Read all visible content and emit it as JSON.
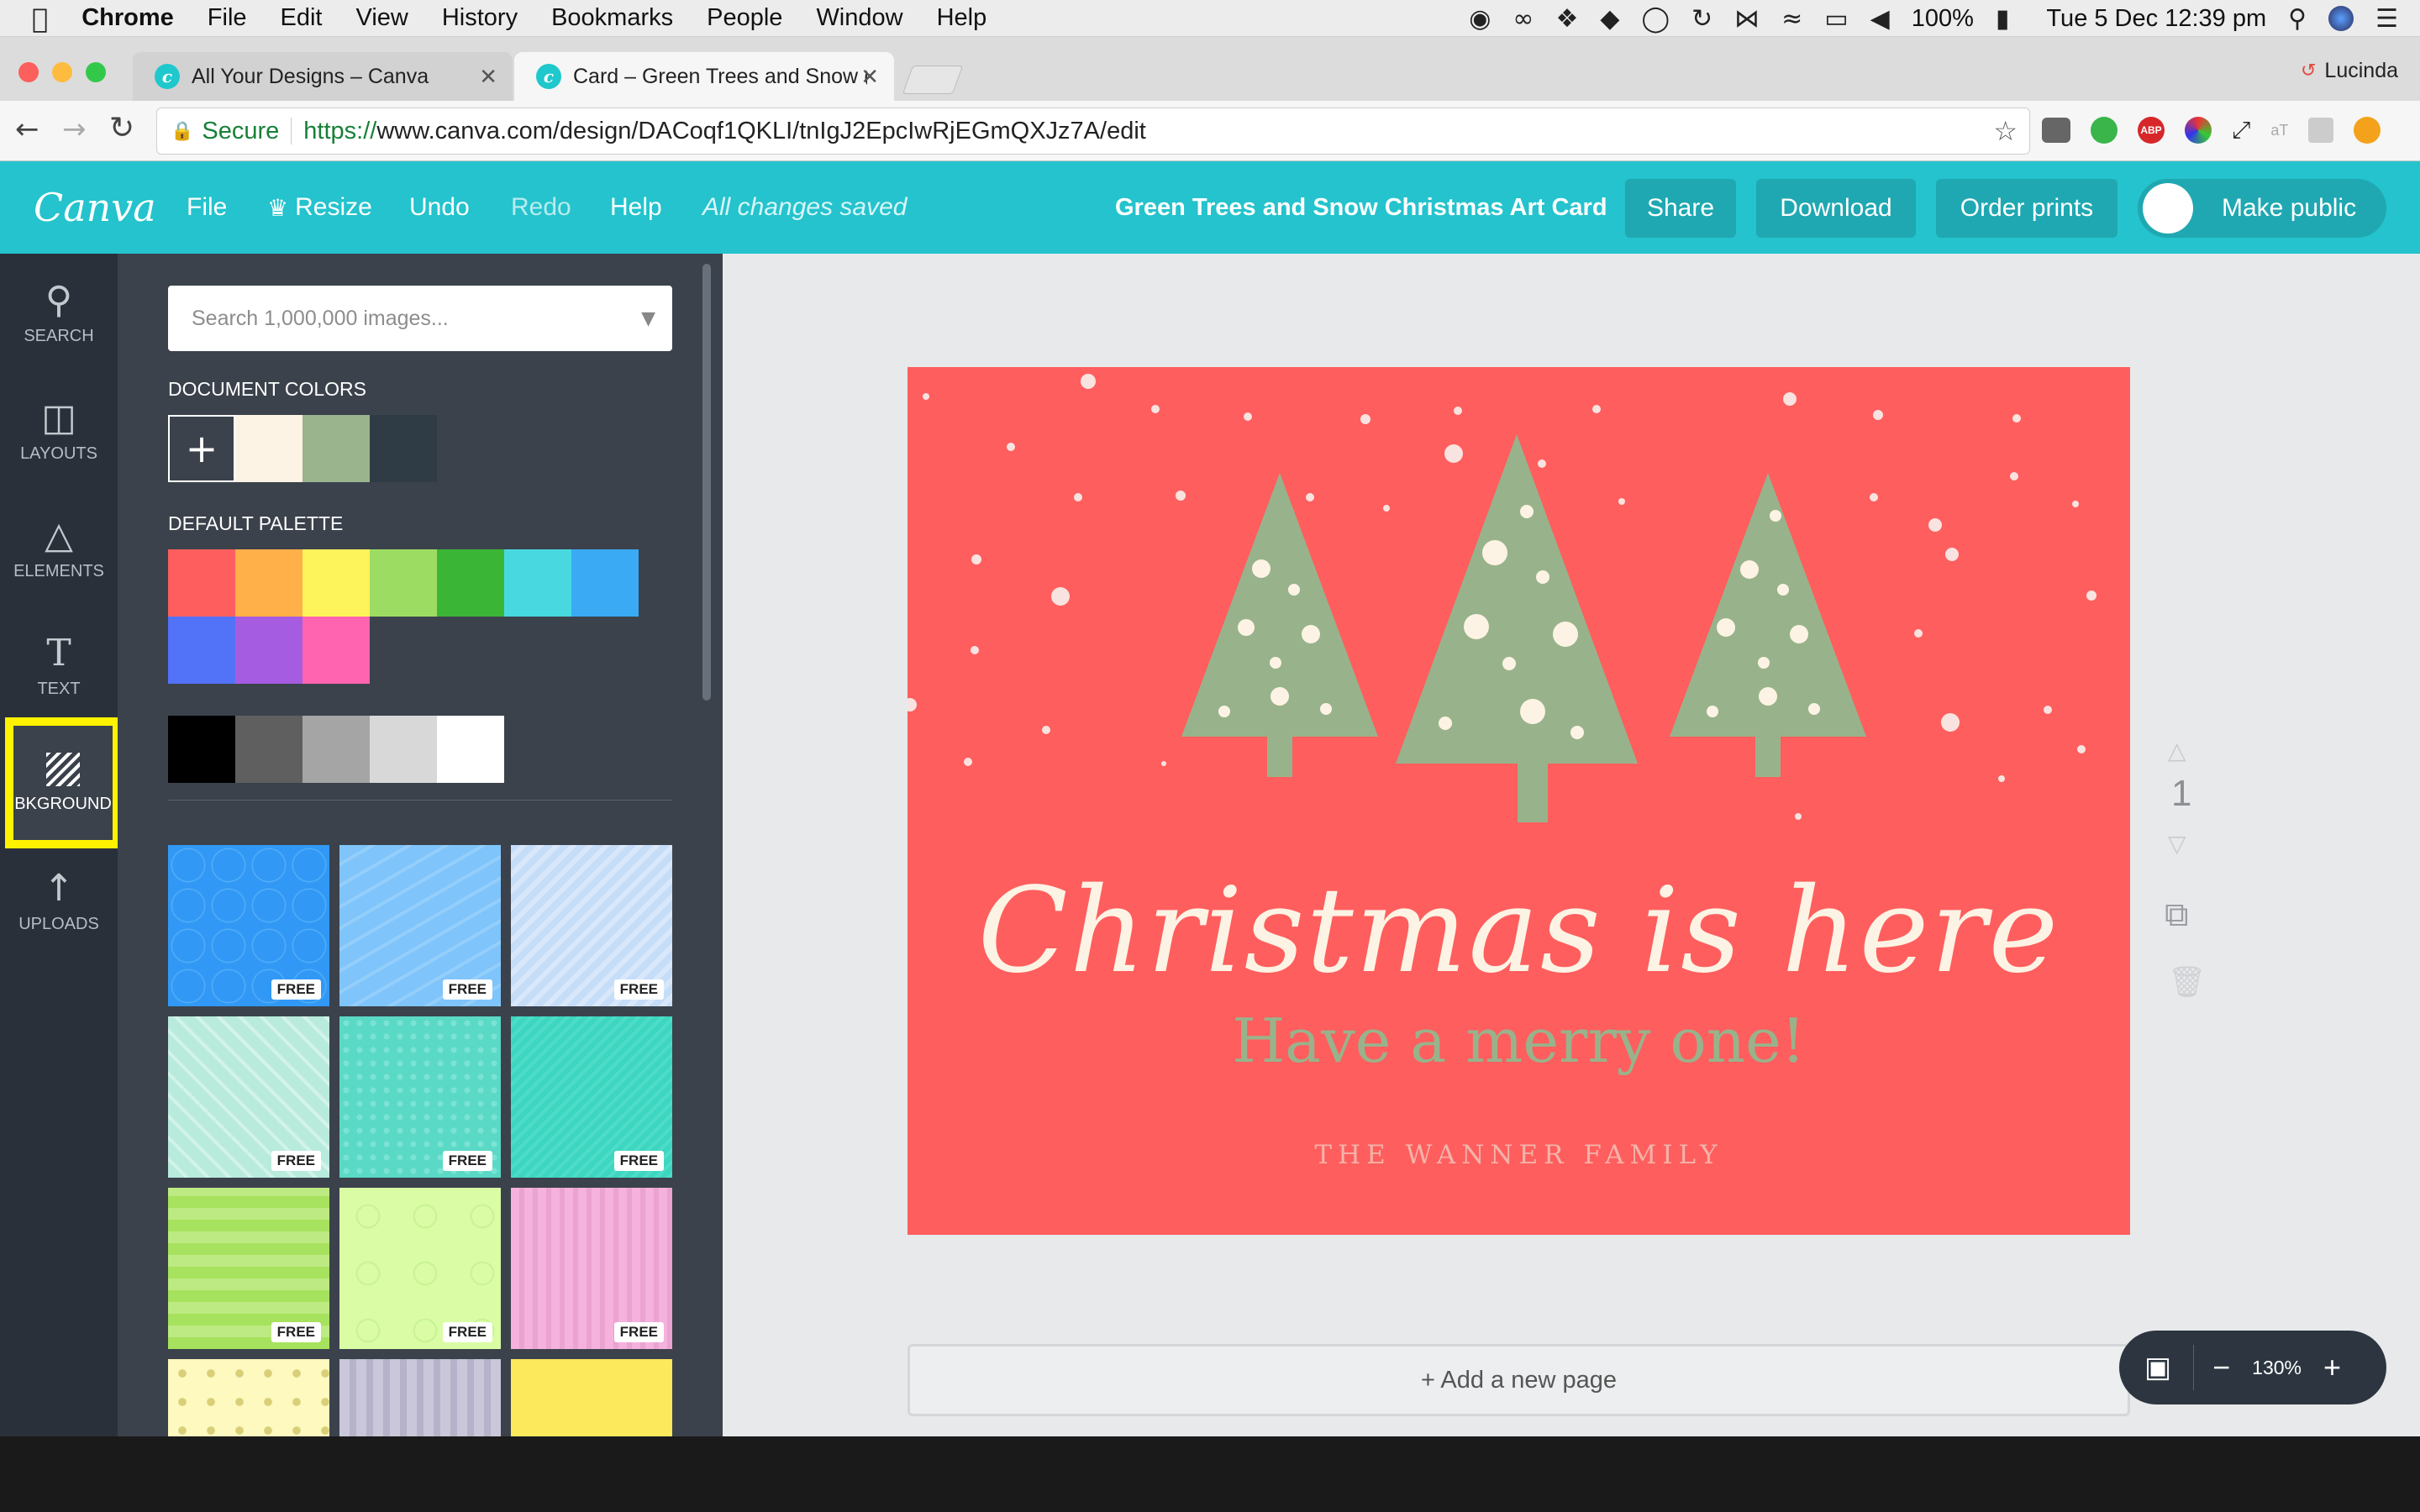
{
  "menubar": {
    "apple_icon": "apple-icon",
    "app_name": "Chrome",
    "items": [
      "File",
      "Edit",
      "View",
      "History",
      "Bookmarks",
      "People",
      "Window",
      "Help"
    ],
    "battery": "100%",
    "datetime": "Tue 5 Dec  12:39 pm"
  },
  "browser": {
    "tabs": [
      {
        "title": "All Your Designs – Canva",
        "active": false
      },
      {
        "title": "Card – Green Trees and Snow (",
        "active": true
      }
    ],
    "profile_name": "Lucinda",
    "secure_label": "Secure",
    "url_scheme": "https://",
    "url_rest": "www.canva.com/design/DACoqf1QKLI/tnIgJ2EpcIwRjEGmQXJz7A/edit"
  },
  "canva_toolbar": {
    "logo": "Canva",
    "file": "File",
    "resize": "Resize",
    "undo": "Undo",
    "redo": "Redo",
    "help": "Help",
    "status": "All changes saved",
    "design_title": "Green Trees and Snow Christmas Art Card",
    "share": "Share",
    "download": "Download",
    "order_prints": "Order prints",
    "make_public": "Make public"
  },
  "sidebar": {
    "items": [
      {
        "label": "SEARCH",
        "icon": "search-icon"
      },
      {
        "label": "LAYOUTS",
        "icon": "layouts-icon"
      },
      {
        "label": "ELEMENTS",
        "icon": "elements-icon"
      },
      {
        "label": "TEXT",
        "icon": "text-icon"
      },
      {
        "label": "BKGROUND",
        "icon": "background-icon"
      },
      {
        "label": "UPLOADS",
        "icon": "uploads-icon"
      }
    ]
  },
  "panel": {
    "search_placeholder": "Search 1,000,000 images...",
    "doc_colors_label": "DOCUMENT COLORS",
    "doc_colors": [
      "#fdf3e4",
      "#9ab48e",
      "#2f3b45"
    ],
    "default_palette_label": "DEFAULT PALETTE",
    "palette_row1": [
      "#ff5e5e",
      "#ffb049",
      "#fdf35b",
      "#9ddc62",
      "#3bb536",
      "#48d9e0",
      "#3aaaf5"
    ],
    "palette_row2": [
      "#5273f7",
      "#a65ce0",
      "#ff64b0"
    ],
    "grays": [
      "#000000",
      "#5f5f5f",
      "#a5a5a5",
      "#d8d8d8",
      "#ffffff"
    ],
    "free_label": "FREE",
    "backgrounds": [
      "#3199f5",
      "#7fc4fb",
      "#c6ddf7",
      "#b8ebdc",
      "#5ad9c6",
      "#3dd6c0",
      "#a7e25e",
      "#d9fca5",
      "#f4b2dd",
      "#fdf9bf",
      "#c9c7d9",
      "#fde95c"
    ]
  },
  "card": {
    "headline": "Christmas is here",
    "subline": "Have a merry one!",
    "family": "THE WANNER FAMILY",
    "bg": "#ff5e5e",
    "tree_color": "#98b38b",
    "text_cream": "#fdf3e4"
  },
  "stage": {
    "page_number": "1",
    "add_page": "+ Add a new page",
    "zoom": "130%"
  }
}
